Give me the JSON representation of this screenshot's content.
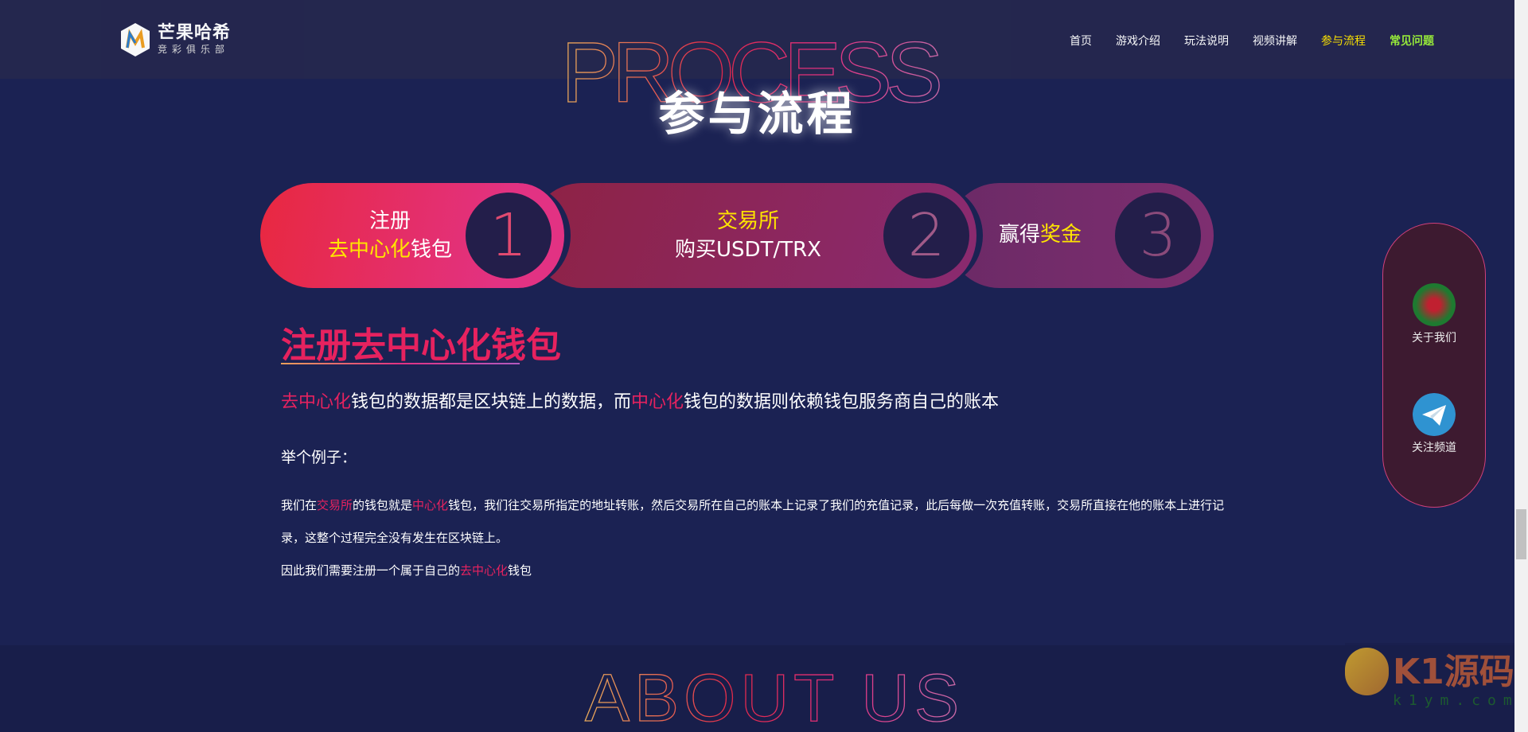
{
  "header": {
    "logo_title": "芒果哈希",
    "logo_sub": "竞彩俱乐部",
    "nav": [
      "首页",
      "游戏介绍",
      "玩法说明",
      "视频讲解",
      "参与流程",
      "常见问题"
    ]
  },
  "hero": {
    "bg_text": "PROCESS",
    "title": "参与流程"
  },
  "steps": [
    {
      "line1": "注册",
      "line2_hl": "去中心化",
      "line2": "钱包",
      "num": "1"
    },
    {
      "line1_hl": "交易所",
      "line2": "购买USDT/TRX",
      "num": "2"
    },
    {
      "text": "赢得",
      "text_hl": "奖金",
      "num": "3"
    }
  ],
  "content": {
    "heading": "注册去中心化钱包",
    "lead": [
      "去中心化",
      "钱包的数据都是区块链上的数据，而",
      "中心化",
      "钱包的数据则依赖钱包服务商自己的账本"
    ],
    "example": "举个例子：",
    "para1": [
      "我们在",
      "交易所",
      "的钱包就是",
      "中心化",
      "钱包，我们往交易所指定的地址转账，然后交易所在自己的账本上记录了我们的充值记录，此后每做一次充值转账，交易所直接在他的账本上进行记录，这整个过程完全没有发生在区块链上。"
    ],
    "para2": [
      "因此我们需要注册一个属于自己的",
      "去中心化",
      "钱包"
    ]
  },
  "about": {
    "bg_text": "ABOUT US"
  },
  "side": {
    "items": [
      {
        "label": "关于我们",
        "icon": "casino-icon"
      },
      {
        "label": "关注频道",
        "icon": "telegram-icon"
      }
    ]
  },
  "watermark": {
    "brand": "K1源码",
    "url": "k1ym.com"
  },
  "colors": {
    "accent": "#e6225f",
    "yellow": "#ffe500",
    "green": "#9af03a",
    "bg": "#1b2253"
  }
}
